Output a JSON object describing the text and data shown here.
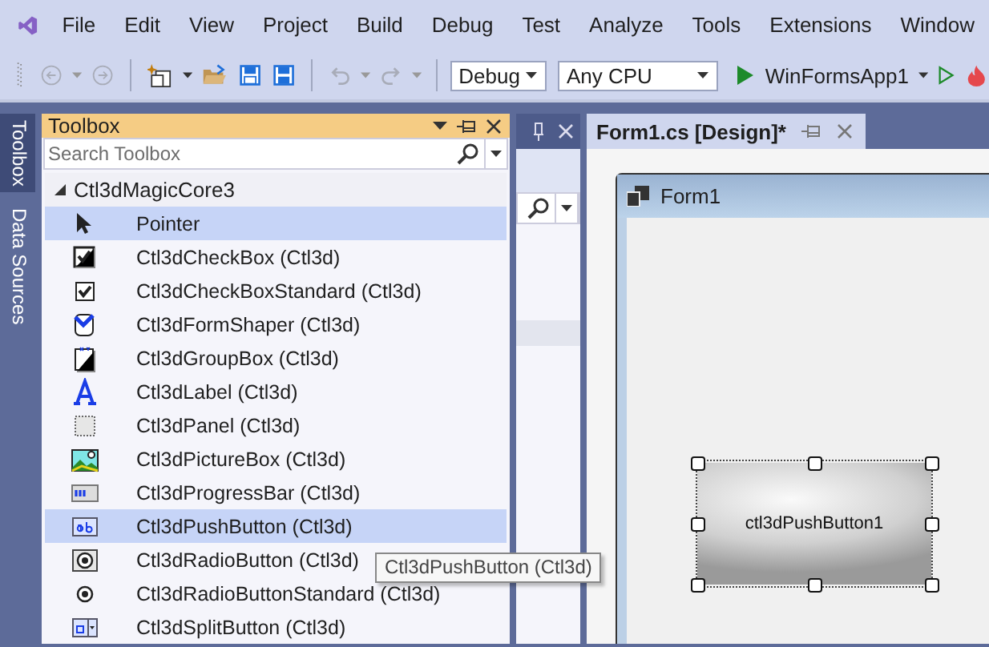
{
  "menu": [
    "File",
    "Edit",
    "View",
    "Project",
    "Build",
    "Debug",
    "Test",
    "Analyze",
    "Tools",
    "Extensions",
    "Window"
  ],
  "toolbar": {
    "configuration": "Debug",
    "platform": "Any CPU",
    "startup": "WinFormsApp1"
  },
  "side_tabs": [
    {
      "label": "Toolbox",
      "selected": true
    },
    {
      "label": "Data Sources",
      "selected": false
    }
  ],
  "toolbox": {
    "title": "Toolbox",
    "search": {
      "placeholder": "Search Toolbox"
    },
    "group": {
      "label": "Ctl3dMagicCore3",
      "expanded": true,
      "items": [
        {
          "kind": "pointer",
          "label": "Pointer",
          "selected": true
        },
        {
          "kind": "checkbox",
          "label": "Ctl3dCheckBox (Ctl3d)",
          "selected": false
        },
        {
          "kind": "checkbox-flat",
          "label": "Ctl3dCheckBoxStandard (Ctl3d)",
          "selected": false
        },
        {
          "kind": "form-shaper",
          "label": "Ctl3dFormShaper (Ctl3d)",
          "selected": false
        },
        {
          "kind": "group-box",
          "label": "Ctl3dGroupBox (Ctl3d)",
          "selected": false
        },
        {
          "kind": "label",
          "label": "Ctl3dLabel (Ctl3d)",
          "selected": false
        },
        {
          "kind": "panel",
          "label": "Ctl3dPanel (Ctl3d)",
          "selected": false
        },
        {
          "kind": "picture-box",
          "label": "Ctl3dPictureBox (Ctl3d)",
          "selected": false
        },
        {
          "kind": "progress-bar",
          "label": "Ctl3dProgressBar (Ctl3d)",
          "selected": false
        },
        {
          "kind": "push-button",
          "label": "Ctl3dPushButton (Ctl3d)",
          "selected": true
        },
        {
          "kind": "radio",
          "label": "Ctl3dRadioButton (Ctl3d)",
          "selected": false
        },
        {
          "kind": "radio-flat",
          "label": "Ctl3dRadioButtonStandard (Ctl3d)",
          "selected": false
        },
        {
          "kind": "split-button",
          "label": "Ctl3dSplitButton (Ctl3d)",
          "selected": false
        }
      ]
    }
  },
  "document_tab": {
    "label": "Form1.cs [Design]*",
    "selected": true
  },
  "form": {
    "title": "Form1",
    "button": {
      "label": "ctl3dPushButton1",
      "selected": true
    }
  },
  "tooltip": "Ctl3dPushButton (Ctl3d)"
}
